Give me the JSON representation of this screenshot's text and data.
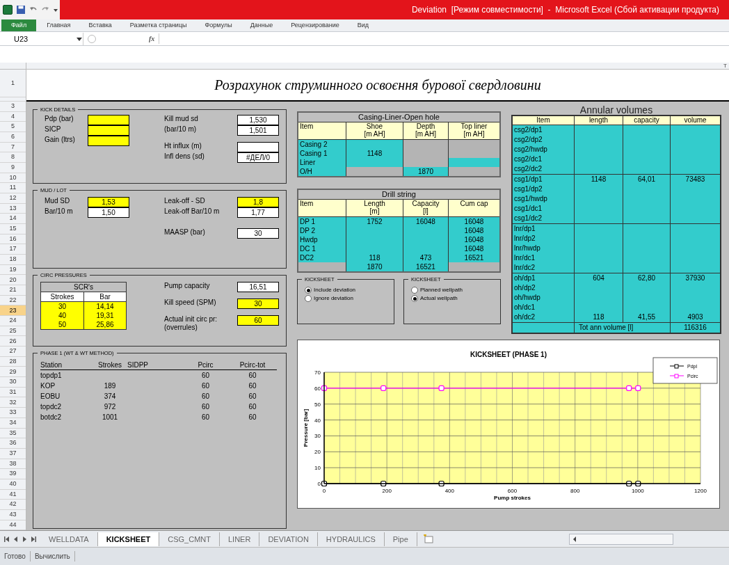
{
  "title_bar": {
    "title": "Deviation  [Режим совместимости]  -  Microsoft Excel (Сбой активации продукта)"
  },
  "ribbon_tabs": [
    {
      "label": "Файл",
      "kind": "file"
    },
    {
      "label": "Главная",
      "kind": "tab"
    },
    {
      "label": "Вставка",
      "kind": "tab"
    },
    {
      "label": "Разметка страницы",
      "kind": "tab"
    },
    {
      "label": "Формулы",
      "kind": "tab"
    },
    {
      "label": "Данные",
      "kind": "tab"
    },
    {
      "label": "Рецензирование",
      "kind": "tab"
    },
    {
      "label": "Вид",
      "kind": "tab"
    }
  ],
  "formula_bar": {
    "name_box": "U23",
    "fx_label": "fx"
  },
  "column_header_visible": "T",
  "row_headers": [
    {
      "label": "1",
      "selected": false
    },
    {
      "label": "3",
      "selected": false
    },
    {
      "label": "4",
      "selected": false
    },
    {
      "label": "5",
      "selected": false
    },
    {
      "label": "6",
      "selected": false
    },
    {
      "label": "7",
      "selected": false
    },
    {
      "label": "8",
      "selected": false
    },
    {
      "label": "9",
      "selected": false
    },
    {
      "label": "10",
      "selected": false
    },
    {
      "label": "11",
      "selected": false
    },
    {
      "label": "12",
      "selected": false
    },
    {
      "label": "13",
      "selected": false
    },
    {
      "label": "14",
      "selected": false
    },
    {
      "label": "15",
      "selected": false
    },
    {
      "label": "16",
      "selected": false
    },
    {
      "label": "17",
      "selected": false
    },
    {
      "label": "18",
      "selected": false
    },
    {
      "label": "19",
      "selected": false
    },
    {
      "label": "20",
      "selected": false
    },
    {
      "label": "21",
      "selected": false
    },
    {
      "label": "22",
      "selected": false
    },
    {
      "label": "23",
      "selected": true
    },
    {
      "label": "24",
      "selected": false
    },
    {
      "label": "25",
      "selected": false
    },
    {
      "label": "26",
      "selected": false
    },
    {
      "label": "27",
      "selected": false
    },
    {
      "label": "28",
      "selected": false
    },
    {
      "label": "29",
      "selected": false
    },
    {
      "label": "30",
      "selected": false
    },
    {
      "label": "31",
      "selected": false
    },
    {
      "label": "32",
      "selected": false
    },
    {
      "label": "33",
      "selected": false
    },
    {
      "label": "34",
      "selected": false
    },
    {
      "label": "35",
      "selected": false
    },
    {
      "label": "36",
      "selected": false
    },
    {
      "label": "37",
      "selected": false
    },
    {
      "label": "38",
      "selected": false
    },
    {
      "label": "39",
      "selected": false
    },
    {
      "label": "40",
      "selected": false
    },
    {
      "label": "41",
      "selected": false
    },
    {
      "label": "42",
      "selected": false
    },
    {
      "label": "43",
      "selected": false
    },
    {
      "label": "44",
      "selected": false
    }
  ],
  "sheet_title": "Розрахунок струминного освоєння бурової свердловини",
  "kick_details": {
    "title": "KICK DETAILS",
    "left_groups": [
      [
        {
          "label": "Pdp (bar)",
          "kind": "input"
        },
        {
          "label": "SICP",
          "kind": "input"
        },
        {
          "label": "Gain (ltrs)",
          "kind": "input"
        }
      ]
    ],
    "right_groups": [
      [
        {
          "label": "Kill mud sd",
          "value": "1,530",
          "kind": "calc"
        },
        {
          "label": "(bar/10 m)",
          "value": "1,501",
          "kind": "calc"
        }
      ],
      [
        {
          "label": "Ht influx (m)",
          "kind": "calc"
        },
        {
          "label": "Infl dens (sd)",
          "value": "#ДЕЛ/0",
          "kind": "calc"
        }
      ]
    ]
  },
  "mud_lot": {
    "title": "MUD / LOT",
    "left_groups": [
      [
        {
          "label": "Mud  SD",
          "value": "1,53",
          "kind": "input"
        },
        {
          "label": "Bar/10 m",
          "value": "1,50",
          "kind": "calc"
        }
      ]
    ],
    "right_groups": [
      [
        {
          "label": "Leak-off - SD",
          "value": "1,8",
          "kind": "input"
        },
        {
          "label": "Leak-off Bar/10 m",
          "value": "1,77",
          "kind": "calc"
        }
      ],
      [
        {
          "label": "MAASP (bar)",
          "value": "30",
          "kind": "calc"
        }
      ]
    ]
  },
  "circ_pressures": {
    "title": "CIRC PRESSURES",
    "scr_table": {
      "title": "SCR's",
      "columns": [
        "Strokes",
        "Bar"
      ],
      "rows": [
        [
          "30",
          "14,14"
        ],
        [
          "40",
          "19,31"
        ],
        [
          "50",
          "25,86"
        ]
      ]
    },
    "right_groups": [
      [
        {
          "label": "Pump capacity",
          "value": "16,51",
          "kind": "calc"
        }
      ],
      [
        {
          "label": "Kill speed (SPM)",
          "value": "30",
          "kind": "input"
        }
      ],
      [
        {
          "label": "Actual init circ pr:",
          "note": "(overrules)",
          "value": "60",
          "kind": "input"
        }
      ]
    ]
  },
  "phase1": {
    "title": "PHASE 1  (WT & WT METHOD)",
    "columns": [
      "Station",
      "Strokes",
      "SIDPP",
      "Pcirc",
      "Pcirc-tot"
    ],
    "rows": [
      [
        "topdp1",
        "",
        "",
        "60",
        "60"
      ],
      [
        "KOP",
        "189",
        "",
        "60",
        "60"
      ],
      [
        "EOBU",
        "374",
        "",
        "60",
        "60"
      ],
      [
        "topdc2",
        "972",
        "",
        "60",
        "60"
      ],
      [
        "botdc2",
        "1001",
        "",
        "60",
        "60"
      ]
    ]
  },
  "casing_table": {
    "title": "Casing-Liner-Open hole",
    "columns": [
      "Item",
      "Shoe\n[m AH]",
      "Depth\n[m AH]",
      "Top liner\n[m AH]"
    ],
    "rows": [
      [
        {
          "text": "Casing 2",
          "filled": true
        },
        {
          "filled": true
        },
        {
          "filled": false
        },
        {
          "filled": false
        }
      ],
      [
        {
          "text": "Casing 1",
          "filled": true
        },
        {
          "text": "1148",
          "filled": true
        },
        {
          "filled": false
        },
        {
          "filled": false
        }
      ],
      [
        {
          "text": "Liner",
          "filled": true
        },
        {
          "filled": true
        },
        {
          "filled": false
        },
        {
          "filled": true
        }
      ],
      [
        {
          "text": "O/H",
          "filled": true
        },
        {
          "filled": false
        },
        {
          "text": "1870",
          "filled": true
        },
        {
          "filled": false
        }
      ]
    ]
  },
  "drill_string": {
    "title": "Drill string",
    "columns": [
      "Item",
      "Length\n[m]",
      "Capacity\n[l]",
      "Cum cap"
    ],
    "rows": [
      [
        {
          "text": "DP 1",
          "filled": true
        },
        {
          "text": "1752",
          "filled": true
        },
        {
          "text": "16048",
          "filled": true
        },
        {
          "text": "16048",
          "filled": true
        }
      ],
      [
        {
          "text": "DP 2",
          "filled": true
        },
        {
          "filled": true
        },
        {
          "filled": true
        },
        {
          "text": "16048",
          "filled": true
        }
      ],
      [
        {
          "text": "Hwdp",
          "filled": true
        },
        {
          "filled": true
        },
        {
          "filled": true
        },
        {
          "text": "16048",
          "filled": true
        }
      ],
      [
        {
          "text": "DC 1",
          "filled": true
        },
        {
          "filled": true
        },
        {
          "filled": true
        },
        {
          "text": "16048",
          "filled": true
        }
      ],
      [
        {
          "text": "DC2",
          "filled": true
        },
        {
          "text": "118",
          "filled": true
        },
        {
          "text": "473",
          "filled": true
        },
        {
          "text": "16521",
          "filled": true
        }
      ],
      [
        {
          "filled": false
        },
        {
          "text": "1870",
          "filled": true
        },
        {
          "text": "16521",
          "filled": true
        },
        {
          "filled": false
        }
      ]
    ]
  },
  "option_groups": [
    {
      "title": "KICKSHEET",
      "options": [
        {
          "label": "Include deviation",
          "selected": true
        },
        {
          "label": "Ignore deviation",
          "selected": false
        }
      ]
    },
    {
      "title": "KICKSHEET",
      "options": [
        {
          "label": "Planned wellpath",
          "selected": false
        },
        {
          "label": "Actual wellpath",
          "selected": true
        }
      ]
    }
  ],
  "annular_volumes": {
    "title": "Annular volumes",
    "columns": [
      "Item",
      "length",
      "capacity",
      "volume"
    ],
    "groups": [
      [
        {
          "item": "csg2/dp1"
        },
        {
          "item": "csg2/dp2"
        },
        {
          "item": "csg2/hwdp"
        },
        {
          "item": "csg2/dc1"
        },
        {
          "item": "csg2/dc2"
        }
      ],
      [
        {
          "item": "csg1/dp1",
          "length": "1148",
          "capacity": "64,01",
          "volume": "73483"
        },
        {
          "item": "csg1/dp2"
        },
        {
          "item": "csg1/hwdp"
        },
        {
          "item": "csg1/dc1"
        },
        {
          "item": "csg1/dc2"
        }
      ],
      [
        {
          "item": "lnr/dp1"
        },
        {
          "item": "lnr/dp2"
        },
        {
          "item": "lnr/hwdp"
        },
        {
          "item": "lnr/dc1"
        },
        {
          "item": "lnr/dc2"
        }
      ],
      [
        {
          "item": "oh/dp1",
          "length": "604",
          "capacity": "62,80",
          "volume": "37930"
        },
        {
          "item": "oh/dp2"
        },
        {
          "item": "oh/hwdp"
        },
        {
          "item": "oh/dc1"
        },
        {
          "item": "oh/dc2",
          "length": "118",
          "capacity": "41,55",
          "volume": "4903"
        }
      ]
    ],
    "total_label": "Tot ann volume [l]",
    "total_value": "116316"
  },
  "chart": {
    "chart_data": {
      "type": "line",
      "title": "KICKSHEET  (PHASE 1)",
      "xlabel": "Pump strokes",
      "ylabel": "Pressure [bar]",
      "x": [
        0,
        189,
        374,
        972,
        1001
      ],
      "series": [
        {
          "name": "Pdpl",
          "color": "#000000",
          "marker": "square",
          "values": [
            0,
            0,
            0,
            0,
            0
          ]
        },
        {
          "name": "Pcirc",
          "color": "#ff00ff",
          "marker": "square",
          "values": [
            60,
            60,
            60,
            60,
            60
          ]
        }
      ],
      "grid": true,
      "legend": true,
      "xlim": [
        0,
        1200
      ],
      "ylim": [
        0,
        70
      ],
      "xticks": [
        {
          "value": 0,
          "label": "0"
        },
        {
          "value": 200,
          "label": "200"
        },
        {
          "value": 400,
          "label": "400"
        },
        {
          "value": 600,
          "label": "600"
        },
        {
          "value": 800,
          "label": "800"
        },
        {
          "value": 1000,
          "label": "1000"
        },
        {
          "value": 1200,
          "label": "1200"
        }
      ],
      "yticks": [
        {
          "value": 0,
          "label": "0"
        },
        {
          "value": 10,
          "label": "10"
        },
        {
          "value": 20,
          "label": "20"
        },
        {
          "value": 30,
          "label": "30"
        },
        {
          "value": 40,
          "label": "40"
        },
        {
          "value": 50,
          "label": "50"
        },
        {
          "value": 60,
          "label": "60"
        },
        {
          "value": 70,
          "label": "70"
        }
      ]
    }
  },
  "sheet_tabs": [
    {
      "label": "WELLDATA",
      "selected": false
    },
    {
      "label": "KICKSHEET",
      "selected": true
    },
    {
      "label": "CSG_CMNT",
      "selected": false
    },
    {
      "label": "LINER",
      "selected": false
    },
    {
      "label": "DEVIATION",
      "selected": false
    },
    {
      "label": "HYDRAULICS",
      "selected": false
    },
    {
      "label": "Pipe",
      "selected": false
    }
  ],
  "status_bar": [
    "Готово",
    "Вычислить"
  ]
}
